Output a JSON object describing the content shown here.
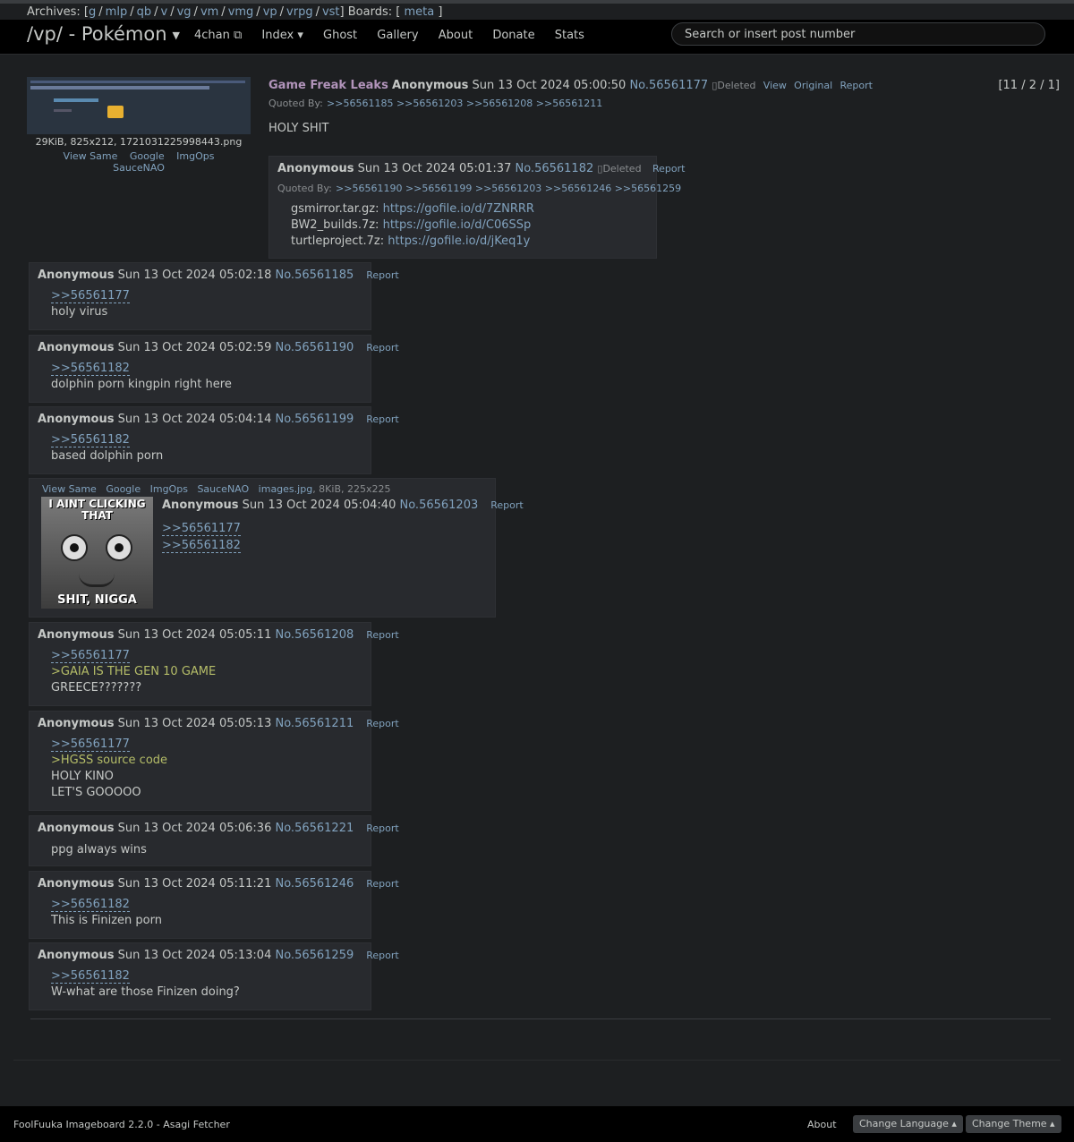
{
  "archives": {
    "label": "Archives:",
    "boards": [
      "g",
      "mlp",
      "qb",
      "v",
      "vg",
      "vm",
      "vmg",
      "vp",
      "vrpg",
      "vst"
    ],
    "boards_label": "Boards:",
    "meta": "meta"
  },
  "header": {
    "board": "/vp/ - Pokémon",
    "nav": [
      "4chan ⧉",
      "Index ▾",
      "Ghost",
      "Gallery",
      "About",
      "Donate",
      "Stats"
    ],
    "search_placeholder": "Search or insert post number"
  },
  "op": {
    "file_info": "29KiB, 825x212, 1721031225998443.png",
    "file_links": [
      "View Same",
      "Google",
      "ImgOps",
      "SauceNAO"
    ],
    "title": "Game Freak Leaks",
    "name": "Anonymous",
    "date": "Sun 13 Oct 2024 05:00:50",
    "num": "No.56561177",
    "deleted": "Deleted",
    "actions": [
      "View",
      "Original",
      "Report"
    ],
    "pager": "[11 / 2 / 1]",
    "quoted_label": "Quoted By:",
    "quoted": ">>56561185 >>56561203 >>56561208 >>56561211",
    "body": "HOLY SHIT"
  },
  "reply182": {
    "name": "Anonymous",
    "date": "Sun 13 Oct 2024 05:01:37",
    "num": "No.56561182",
    "deleted": "Deleted",
    "report": "Report",
    "quoted_label": "Quoted By:",
    "quoted": ">>56561190 >>56561199 >>56561203 >>56561246 >>56561259",
    "lines": [
      {
        "label": "gsmirror.tar.gz:",
        "link": "https://gofile.io/d/7ZNRRR"
      },
      {
        "label": "BW2_builds.7z:",
        "link": "https://gofile.io/d/C06SSp"
      },
      {
        "label": "turtleproject.7z:",
        "link": "https://gofile.io/d/jKeq1y"
      }
    ]
  },
  "replies": [
    {
      "name": "Anonymous",
      "date": "Sun 13 Oct 2024 05:02:18",
      "num": "No.56561185",
      "report": "Report",
      "ql": [
        ">>56561177"
      ],
      "gt": [],
      "text": [
        "holy virus"
      ]
    },
    {
      "name": "Anonymous",
      "date": "Sun 13 Oct 2024 05:02:59",
      "num": "No.56561190",
      "report": "Report",
      "ql": [
        ">>56561182"
      ],
      "gt": [],
      "text": [
        "dolphin porn kingpin right here"
      ]
    },
    {
      "name": "Anonymous",
      "date": "Sun 13 Oct 2024 05:04:14",
      "num": "No.56561199",
      "report": "Report",
      "ql": [
        ">>56561182"
      ],
      "gt": [],
      "text": [
        "based dolphin porn"
      ]
    },
    {
      "name": "Anonymous",
      "date": "Sun 13 Oct 2024 05:05:11",
      "num": "No.56561208",
      "report": "Report",
      "ql": [
        ">>56561177"
      ],
      "gt": [
        ">GAIA IS THE GEN 10 GAME"
      ],
      "text": [
        "GREECE???????"
      ]
    },
    {
      "name": "Anonymous",
      "date": "Sun 13 Oct 2024 05:05:13",
      "num": "No.56561211",
      "report": "Report",
      "ql": [
        ">>56561177"
      ],
      "gt": [
        ">HGSS source code"
      ],
      "text": [
        "HOLY KINO",
        "LET'S GOOOOO"
      ]
    },
    {
      "name": "Anonymous",
      "date": "Sun 13 Oct 2024 05:06:36",
      "num": "No.56561221",
      "report": "Report",
      "ql": [],
      "gt": [],
      "text": [
        "ppg always wins"
      ]
    },
    {
      "name": "Anonymous",
      "date": "Sun 13 Oct 2024 05:11:21",
      "num": "No.56561246",
      "report": "Report",
      "ql": [
        ">>56561182"
      ],
      "gt": [],
      "text": [
        "This is Finizen porn"
      ]
    },
    {
      "name": "Anonymous",
      "date": "Sun 13 Oct 2024 05:13:04",
      "num": "No.56561259",
      "report": "Report",
      "ql": [
        ">>56561182"
      ],
      "gt": [],
      "text": [
        "W-what are those Finizen doing?"
      ]
    }
  ],
  "reply203": {
    "file_links": [
      "View Same",
      "Google",
      "ImgOps",
      "SauceNAO"
    ],
    "file_name": "images.jpg",
    "file_info": ", 8KiB, 225x225",
    "image_text_top": "I AINT CLICKING THAT",
    "image_text_bottom": "SHIT, NIGGA",
    "name": "Anonymous",
    "date": "Sun 13 Oct 2024 05:04:40",
    "num": "No.56561203",
    "report": "Report",
    "ql": [
      ">>56561177",
      ">>56561182"
    ]
  },
  "footer": {
    "engine": "FoolFuuka Imageboard 2.2.0 - Asagi Fetcher",
    "about": "About",
    "change_language": "Change Language ▴",
    "change_theme": "Change Theme ▴"
  }
}
